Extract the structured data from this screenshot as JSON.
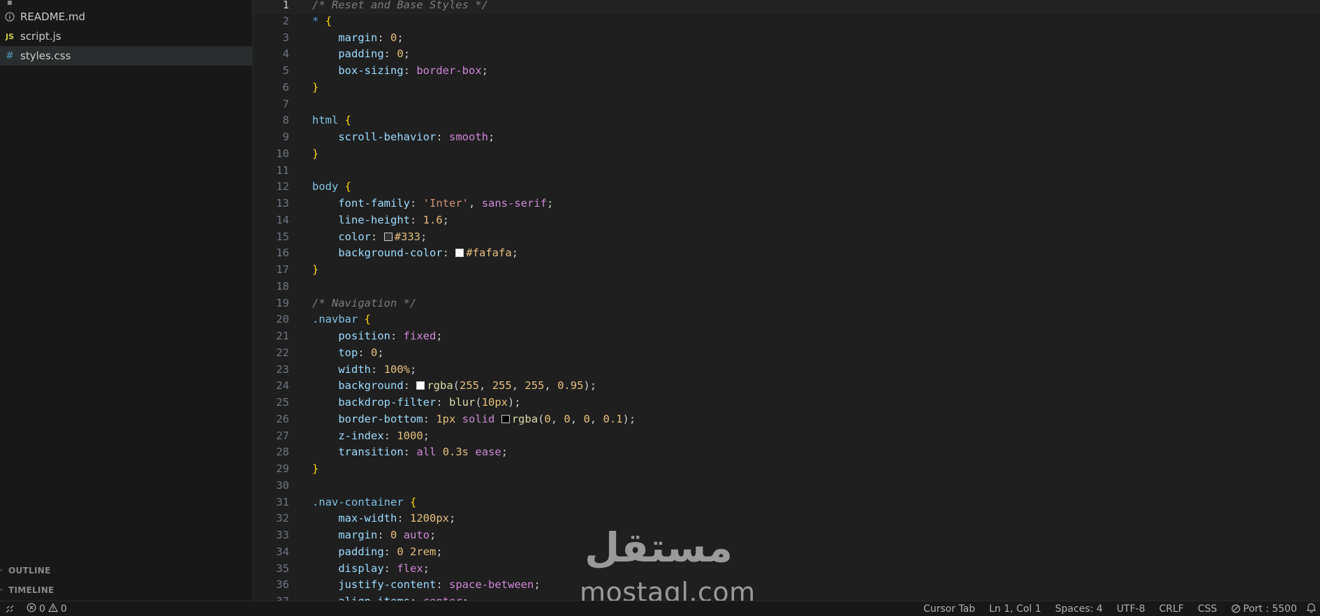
{
  "sidebar": {
    "files": [
      {
        "name": "README.md",
        "icon": "info-icon",
        "active": false
      },
      {
        "name": "script.js",
        "icon": "js-file-icon",
        "active": false
      },
      {
        "name": "styles.css",
        "icon": "css-file-icon",
        "active": true
      }
    ],
    "panels": {
      "outline": "OUTLINE",
      "timeline": "TIMELINE"
    }
  },
  "editor": {
    "language": "CSS",
    "active_line": 1,
    "lines": [
      "/* Reset and Base Styles */",
      "* {",
      "    margin: 0;",
      "    padding: 0;",
      "    box-sizing: border-box;",
      "}",
      "",
      "html {",
      "    scroll-behavior: smooth;",
      "}",
      "",
      "body {",
      "    font-family: 'Inter', sans-serif;",
      "    line-height: 1.6;",
      "    color: #333;",
      "    background-color: #fafafa;",
      "}",
      "",
      "/* Navigation */",
      ".navbar {",
      "    position: fixed;",
      "    top: 0;",
      "    width: 100%;",
      "    background: rgba(255, 255, 255, 0.95);",
      "    backdrop-filter: blur(10px);",
      "    border-bottom: 1px solid rgba(0, 0, 0, 0.1);",
      "    z-index: 1000;",
      "    transition: all 0.3s ease;",
      "}",
      "",
      ".nav-container {",
      "    max-width: 1200px;",
      "    margin: 0 auto;",
      "    padding: 0 2rem;",
      "    display: flex;",
      "    justify-content: space-between;",
      "    align-items: center;"
    ],
    "swatches": {
      "15": "#333333",
      "16": "#fafafa",
      "24": "#ffffff",
      "26": "#000000"
    }
  },
  "watermark": {
    "arabic": "مستقل",
    "latin": "mostaql.com"
  },
  "statusbar": {
    "errors": "0",
    "warnings": "0",
    "cursor_tab": "Cursor Tab",
    "position": "Ln 1, Col 1",
    "spaces": "Spaces: 4",
    "encoding": "UTF-8",
    "eol": "CRLF",
    "language": "CSS",
    "port": "Port : 5500"
  }
}
